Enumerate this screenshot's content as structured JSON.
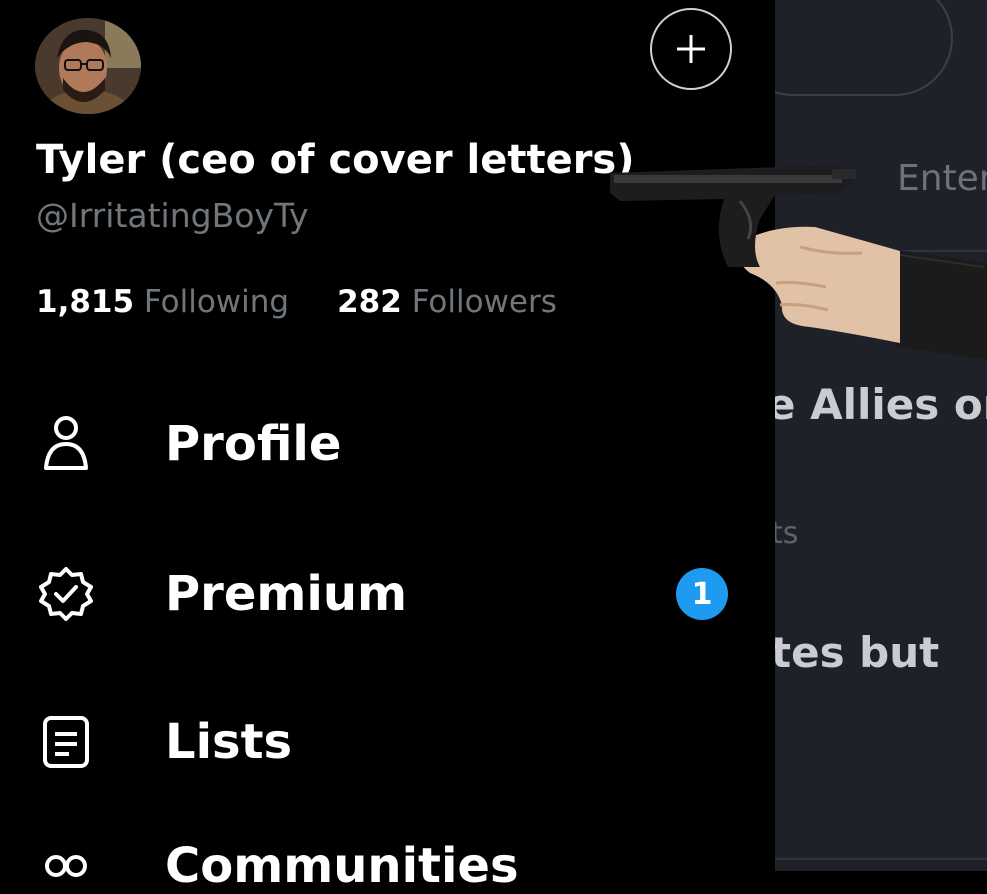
{
  "profile": {
    "display_name": "Tyler (ceo of cover letters)",
    "handle": "@IrritatingBoyTy",
    "following_count": "1,815",
    "following_label": "Following",
    "followers_count": "282",
    "followers_label": "Followers"
  },
  "nav": {
    "items": [
      {
        "label": "Profile",
        "icon": "person-icon"
      },
      {
        "label": "Premium",
        "icon": "verified-badge-icon",
        "badge": "1"
      },
      {
        "label": "Lists",
        "icon": "list-icon"
      },
      {
        "label": "Communities",
        "icon": "communities-icon"
      }
    ]
  },
  "background_feed": {
    "tab_text": "Enter",
    "line1": "e Allies or",
    "line2": "ts",
    "line3": "tes but"
  },
  "colors": {
    "background": "#000000",
    "secondary_text": "#71767b",
    "badge": "#1d9bf0",
    "feed_background": "#1e2228"
  }
}
